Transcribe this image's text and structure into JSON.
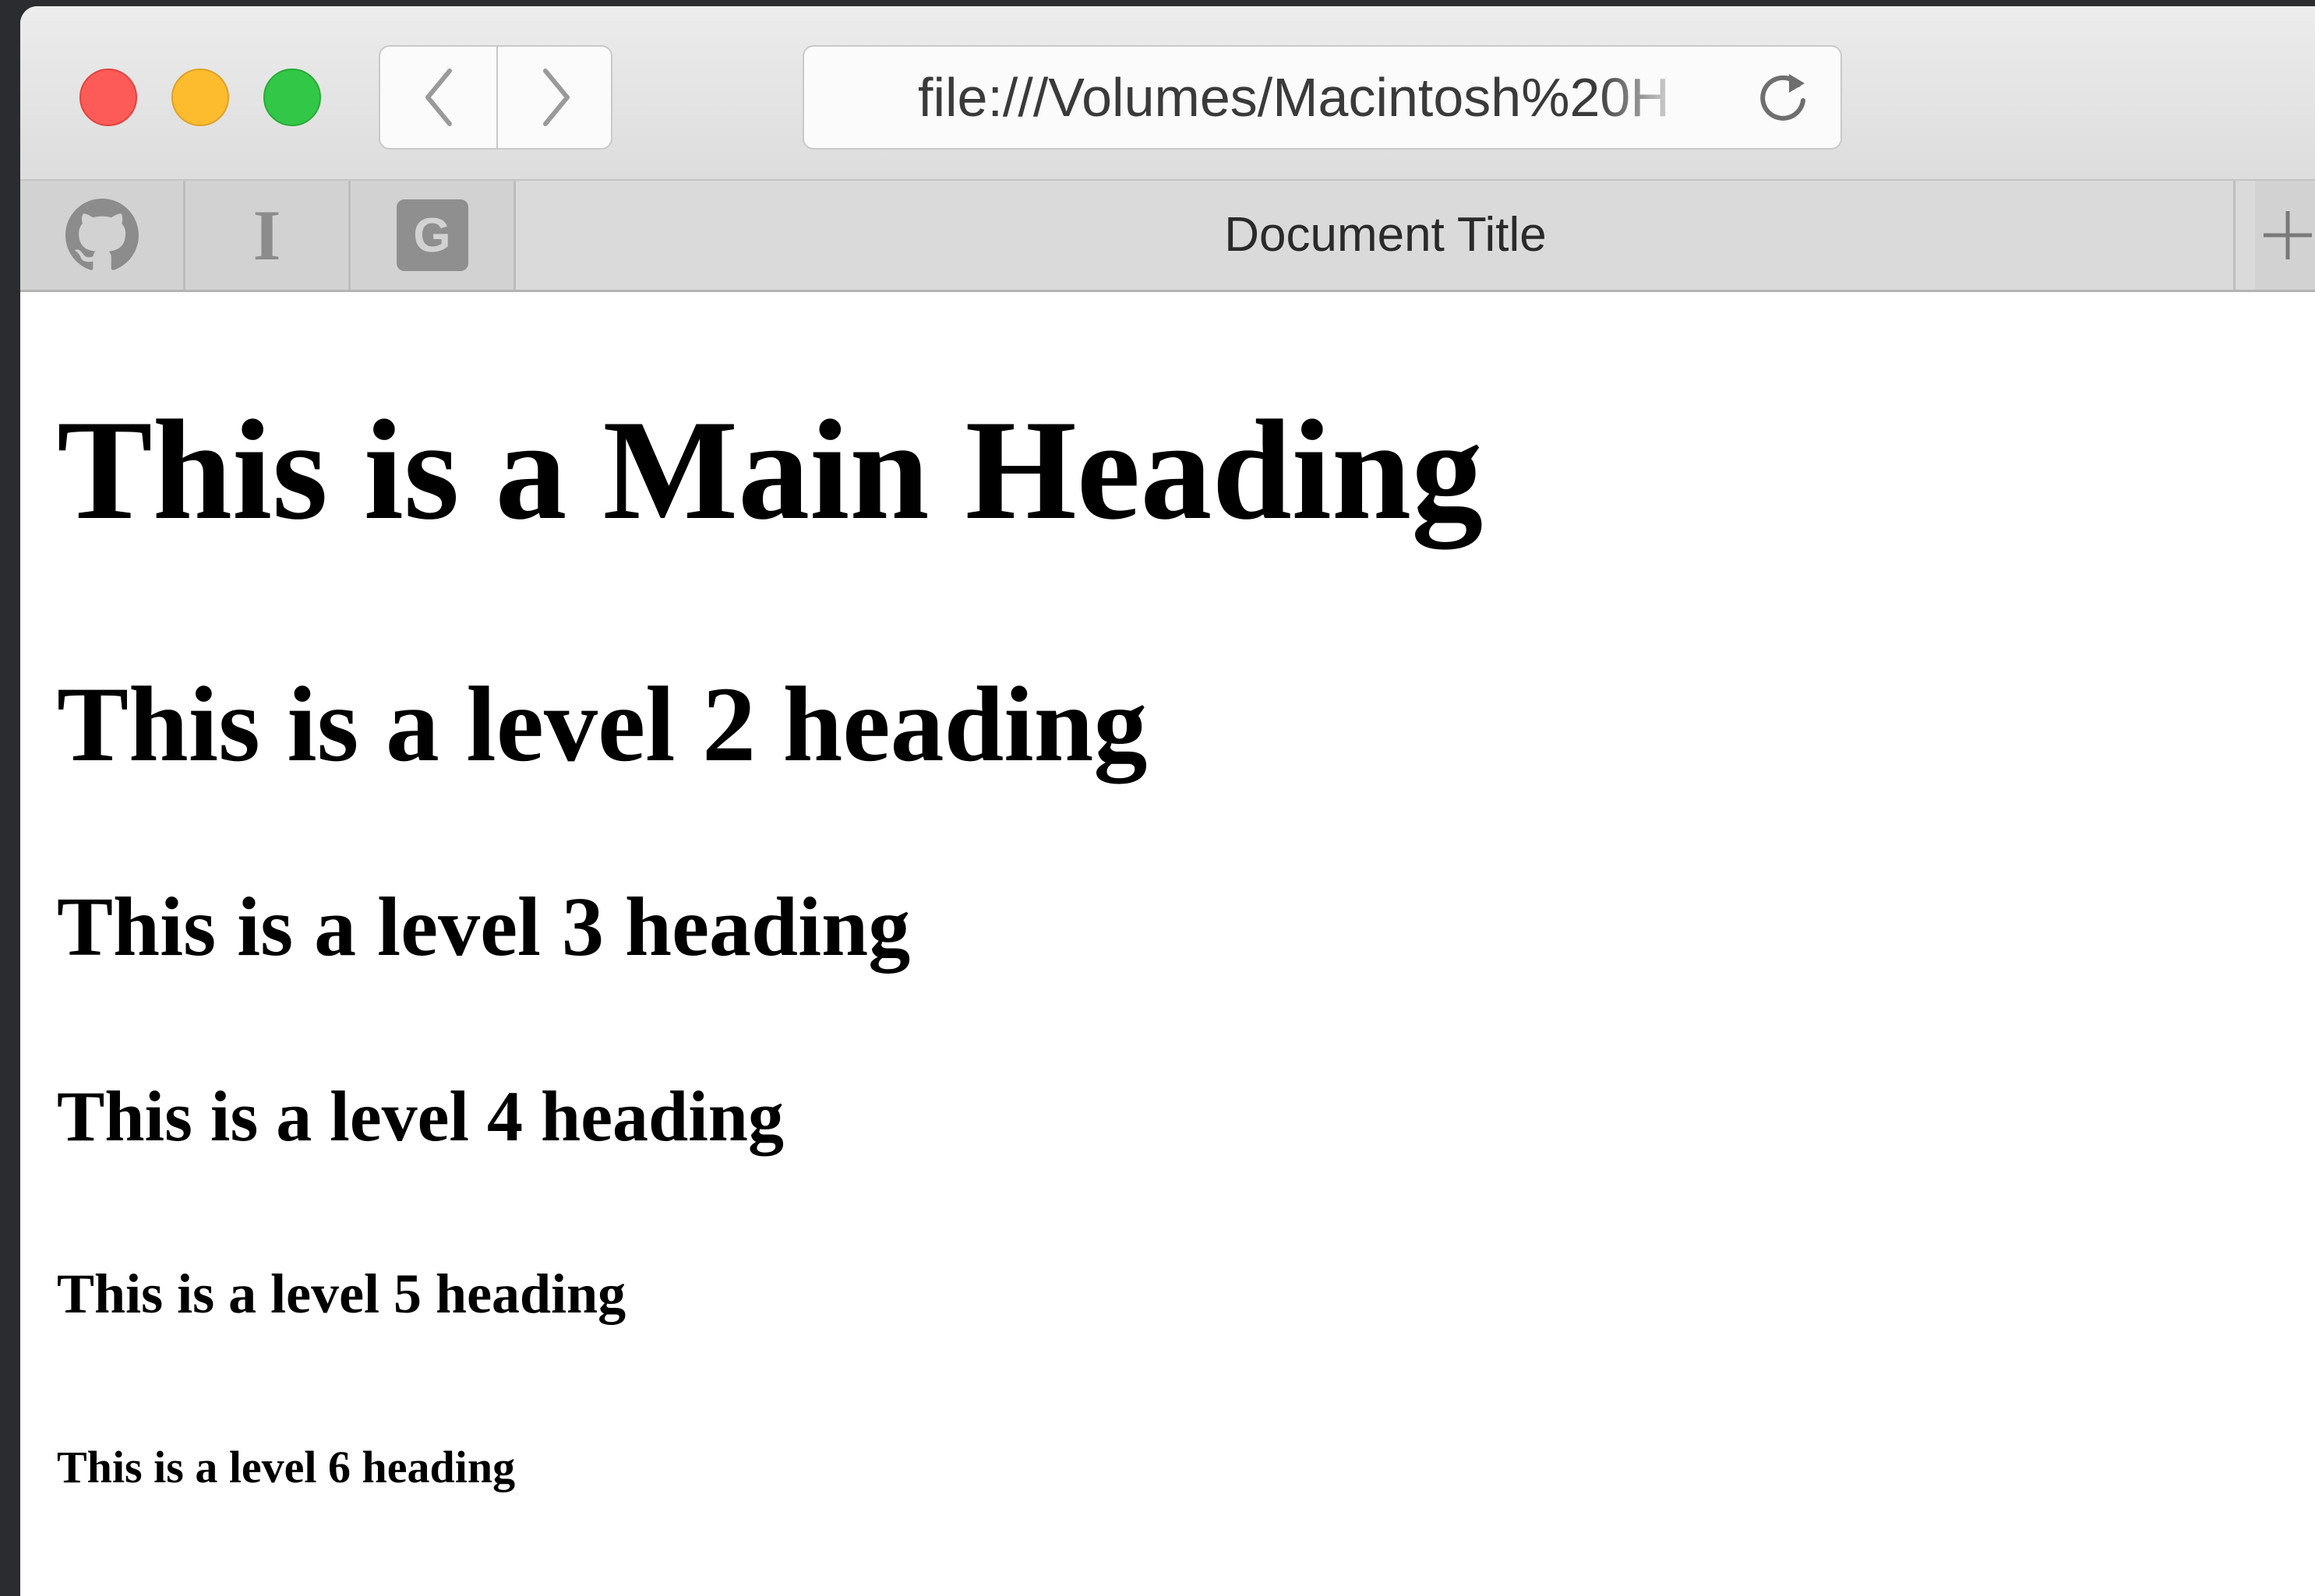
{
  "window": {
    "controls": {
      "close": "close-button",
      "minimize": "minimize-button",
      "maximize": "zoom-button"
    }
  },
  "toolbar": {
    "back_icon": "chevron-left-icon",
    "forward_icon": "chevron-right-icon",
    "url": "file:///Volumes/Macintosh%20H",
    "reload_icon": "reload-icon"
  },
  "favorites": [
    {
      "icon": "github-icon"
    },
    {
      "icon": "text-cursor-icon",
      "glyph": "I"
    },
    {
      "icon": "google-icon",
      "glyph": "G"
    }
  ],
  "tab": {
    "title": "Document Title",
    "new_tab_icon": "plus-icon"
  },
  "page": {
    "h1": "This is a Main Heading",
    "h2": "This is a level 2 heading",
    "h3": "This is a level 3 heading",
    "h4": "This is a level 4 heading",
    "h5": "This is a level 5 heading",
    "h6": "This is a level 6 heading"
  },
  "colors": {
    "close": "#fc5b57",
    "minimize": "#fdbc2e",
    "maximize": "#33c748",
    "desktop": "#2b2c30"
  }
}
